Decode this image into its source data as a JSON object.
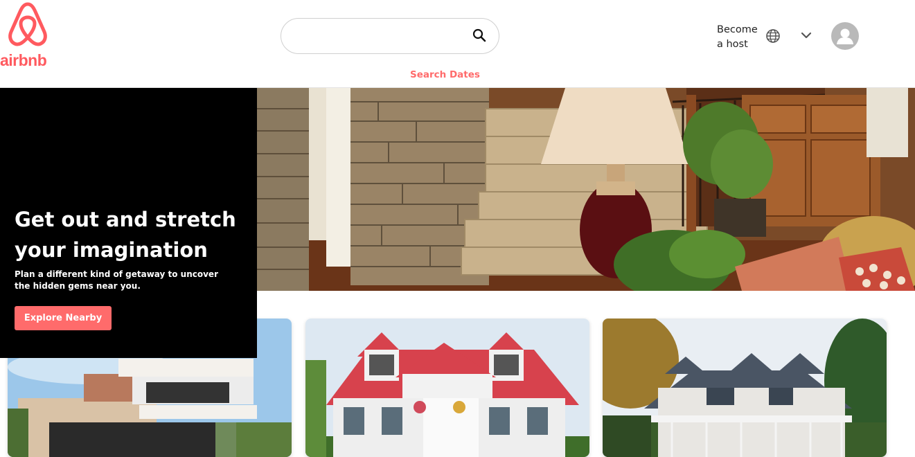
{
  "brand": {
    "name": "airbnb",
    "color": "#ff5a5f"
  },
  "header": {
    "search": {
      "value": "",
      "placeholder": "",
      "icon": "search-icon"
    },
    "search_dates_label": "Search Dates",
    "become_host_label": "Become a host",
    "language_icon": "globe-icon",
    "menu_icon": "chevron-down-icon",
    "avatar_icon": "user-avatar-icon"
  },
  "promo": {
    "title": "Get out and stretch your imagination",
    "subtitle": "Plan a different kind of getaway to uncover the hidden gems near you.",
    "button_label": "Explore Nearby"
  },
  "colors": {
    "accent": "#ff6b6b",
    "promo_bg": "#000000"
  }
}
